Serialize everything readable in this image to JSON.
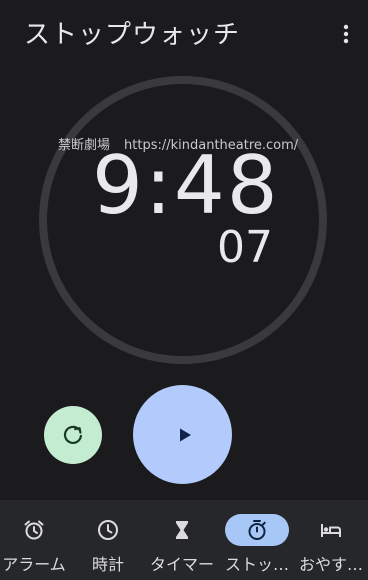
{
  "app_bar": {
    "title": "ストップウォッチ",
    "menu_icon": "more-vert-icon"
  },
  "overlay": {
    "site_name": "禁断劇場",
    "url": "https://kindantheatre.com/"
  },
  "stopwatch": {
    "time": "9:48",
    "hundredths": "07",
    "reset_icon": "reset-icon",
    "play_icon": "play-icon"
  },
  "colors": {
    "background": "#1b1b1d",
    "dial_ring": "#3a3a3c",
    "reset_button": "#c4ecd0",
    "play_button": "#b3cafc",
    "nav_active_pill": "#a7c8f6",
    "nav_background": "#26272b"
  },
  "nav": {
    "items": [
      {
        "label": "アラーム",
        "icon": "alarm-icon",
        "active": false
      },
      {
        "label": "時計",
        "icon": "clock-icon",
        "active": false
      },
      {
        "label": "タイマー",
        "icon": "hourglass-icon",
        "active": false
      },
      {
        "label": "ストッ…",
        "icon": "stopwatch-icon",
        "active": true
      },
      {
        "label": "おやす…",
        "icon": "bed-icon",
        "active": false
      }
    ]
  }
}
